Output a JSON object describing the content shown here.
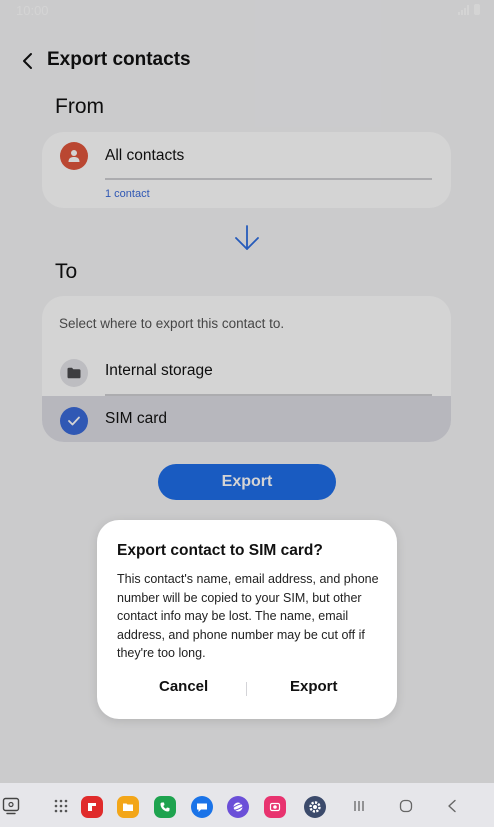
{
  "status": {
    "time": "10:00"
  },
  "app_bar": {
    "title": "Export contacts"
  },
  "from": {
    "label": "From",
    "name": "All contacts",
    "count": "1 contact"
  },
  "to": {
    "label": "To",
    "hint": "Select where to export this contact to.",
    "options": [
      {
        "label": "Internal storage",
        "icon": "folder-icon",
        "selected": false
      },
      {
        "label": "SIM card",
        "icon": "check-icon",
        "selected": true
      }
    ]
  },
  "export_button": {
    "label": "Export"
  },
  "dialog": {
    "title": "Export contact to SIM card?",
    "body": "This contact's name, email address, and phone number will be copied to your SIM, but other contact info may be lost. The name, email address, and phone number may be cut off if they're too long.",
    "cancel_label": "Cancel",
    "confirm_label": "Export"
  },
  "taskbar": {
    "apps": [
      "recent-apps-icon",
      "app-drawer-icon",
      "flipboard-icon",
      "my-files-icon",
      "phone-icon",
      "messages-icon",
      "internet-icon",
      "screen-recorder-icon",
      "settings-icon"
    ],
    "nav": [
      "recents-icon",
      "home-icon",
      "back-icon"
    ]
  },
  "colors": {
    "accent": "#1f6ee8",
    "link": "#3a6ad9",
    "avatar": "#e0563d",
    "selected_row": "#dcdce4"
  }
}
